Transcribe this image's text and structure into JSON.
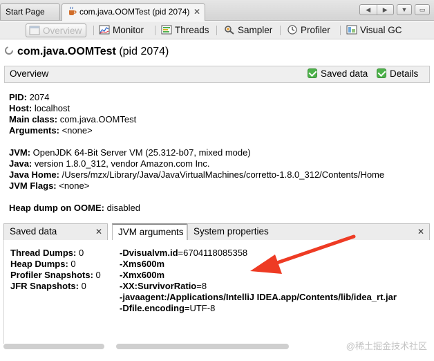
{
  "doc_tabs": [
    {
      "label": "Start Page"
    },
    {
      "label": "com.java.OOMTest (pid 2074)"
    }
  ],
  "toolbar": {
    "overview": "Overview",
    "monitor": "Monitor",
    "threads": "Threads",
    "sampler": "Sampler",
    "profiler": "Profiler",
    "visual_gc": "Visual GC"
  },
  "title": {
    "app": "com.java.OOMTest",
    "pid": "(pid 2074)"
  },
  "overview": {
    "title": "Overview",
    "saved_data_cb": "Saved data",
    "details_cb": "Details"
  },
  "info": [
    {
      "label": "PID:",
      "value": " 2074"
    },
    {
      "label": "Host:",
      "value": " localhost"
    },
    {
      "label": "Main class:",
      "value": " com.java.OOMTest"
    },
    {
      "label": "Arguments:",
      "value": " <none>"
    },
    {
      "label": "JVM:",
      "value": " OpenJDK 64-Bit Server VM (25.312-b07, mixed mode)"
    },
    {
      "label": "Java:",
      "value": " version 1.8.0_312, vendor Amazon.com Inc."
    },
    {
      "label": "Java Home:",
      "value": " /Users/mzx/Library/Java/JavaVirtualMachines/corretto-1.8.0_312/Contents/Home"
    },
    {
      "label": "JVM Flags:",
      "value": " <none>"
    },
    {
      "label": "Heap dump on OOME:",
      "value": " disabled"
    }
  ],
  "left_panel": {
    "tab": "Saved data",
    "rows": [
      {
        "label": "Thread Dumps:",
        "value": " 0"
      },
      {
        "label": "Heap Dumps:",
        "value": " 0"
      },
      {
        "label": "Profiler Snapshots:",
        "value": " 0"
      },
      {
        "label": "JFR Snapshots:",
        "value": " 0"
      }
    ]
  },
  "right_panel": {
    "tabs": [
      "JVM arguments",
      "System properties"
    ],
    "args": [
      {
        "flag": "-Dvisualvm.id",
        "value": "=6704118085358"
      },
      {
        "flag": "-Xms600m",
        "value": ""
      },
      {
        "flag": "-Xmx600m",
        "value": ""
      },
      {
        "flag": "-XX:SurvivorRatio",
        "value": "=8"
      },
      {
        "flag": "-javaagent:/Applications/IntelliJ IDEA.app/Contents/lib/idea_rt.jar",
        "value": ""
      },
      {
        "flag": "-Dfile.encoding",
        "value": "=UTF-8"
      }
    ]
  },
  "watermark": "@稀土掘金技术社区",
  "icons": {
    "doc_tab": "java-coffee-icon",
    "overview": "overview-icon",
    "monitor": "monitor-chart-icon",
    "threads": "threads-icon",
    "sampler": "sampler-icon",
    "profiler": "profiler-clock-icon",
    "visual_gc": "visual-gc-icon",
    "title": "spinner-icon",
    "annotation": "red-arrow"
  },
  "colors": {
    "checkbox": "#4db14a",
    "arrow": "#ee3b24",
    "header_bg": "#efefef"
  }
}
